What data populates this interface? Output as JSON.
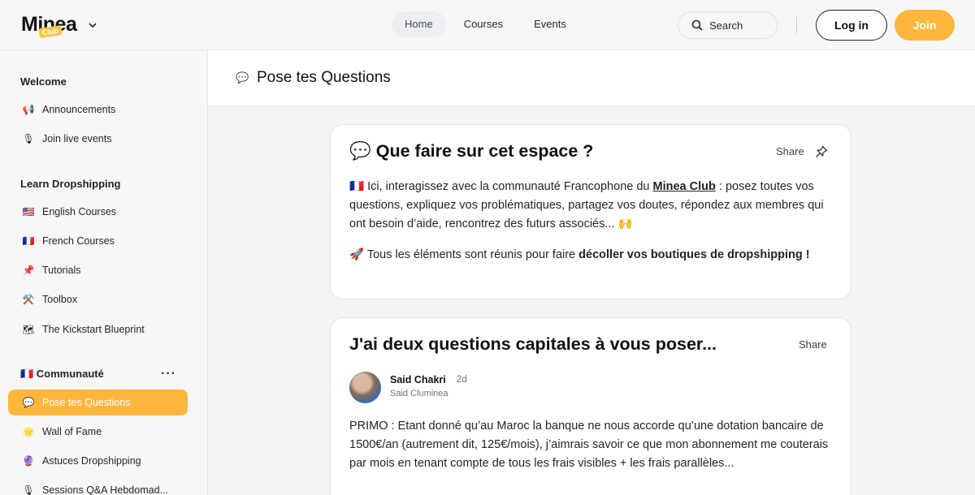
{
  "header": {
    "logo": "Minea",
    "logo_badge": "Club",
    "nav": [
      "Home",
      "Courses",
      "Events"
    ],
    "search_label": "Search",
    "login_label": "Log in",
    "join_label": "Join"
  },
  "sidebar": {
    "sections": [
      {
        "title": "Welcome",
        "items": [
          {
            "emoji": "📢",
            "label": "Announcements"
          },
          {
            "emoji": "🎙",
            "label": "Join live events"
          }
        ]
      },
      {
        "title": "Learn Dropshipping",
        "items": [
          {
            "emoji": "🇺🇸",
            "label": "English Courses"
          },
          {
            "emoji": "🇫🇷",
            "label": "French Courses"
          },
          {
            "emoji": "📌",
            "label": "Tutorials"
          },
          {
            "emoji": "⚒️",
            "label": "Toolbox"
          },
          {
            "emoji": "🗺",
            "label": "The Kickstart Blueprint"
          }
        ]
      },
      {
        "title": "🇫🇷 Communauté",
        "items": [
          {
            "emoji": "💬",
            "label": "Pose tes Questions"
          },
          {
            "emoji": "🌟",
            "label": "Wall of Fame"
          },
          {
            "emoji": "🔮",
            "label": "Astuces Dropshipping"
          },
          {
            "emoji": "🎙",
            "label": "Sessions Q&A Hebdomad..."
          }
        ]
      }
    ],
    "more_label": "···"
  },
  "page": {
    "icon": "💬",
    "title": "Pose tes Questions"
  },
  "cards": [
    {
      "title_emoji": "💬",
      "title": "Que faire sur cet espace ?",
      "share": "Share",
      "p1_flag": "🇫🇷",
      "p1_a": " Ici, interagissez avec la communauté Francophone du ",
      "p1_link": "Minea Club",
      "p1_b": " : posez toutes vos questions, expliquez vos problématiques, partagez vos doutes, répondez aux membres qui ont besoin d’aide, rencontrez des futurs associés... 🙌",
      "p2_emoji": "🚀",
      "p2_a": " Tous les éléments sont réunis pour faire ",
      "p2_bold": "décoller vos boutiques de dropshipping !"
    },
    {
      "title": "J'ai deux questions capitales à vous poser...",
      "share": "Share",
      "author": "Said Chakri",
      "time": "2d",
      "author_sub": "Said Cluminea",
      "body": "PRIMO : Etant donné qu’au Maroc la banque ne nous accorde qu’une dotation bancaire de 1500€/an (autrement dit, 125€/mois), j’aimrais savoir ce que mon abonnement me couterais par mois en tenant compte de tous les frais visibles + les frais parallèles..."
    }
  ]
}
